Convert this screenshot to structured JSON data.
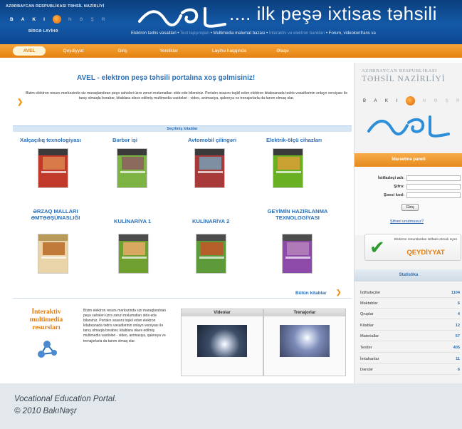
{
  "header": {
    "ministry": "AZƏRBAYCAN RESPUBLİKASI TƏHSİL NAZİRLİYİ",
    "baki_letters": [
      "B",
      "A",
      "K",
      "I"
    ],
    "nesr_letters": [
      "N",
      "Ə",
      "Ş",
      "R"
    ],
    "project": "BİRGƏ LAYİHƏ",
    "title": ".... ilk peşə ixtisas təhsili",
    "links_1": "Elektron tədris vəsaitləri •",
    "links_faded_1": " Test tapşırıqları ",
    "links_2": "• Multimedia məlumat bazası •",
    "links_faded_2": " İnteraktiv və elektron bankları ",
    "links_3": "• Forum, videokonfrans və"
  },
  "nav": {
    "items": [
      "AVEL",
      "Qeydiyyat",
      "Giriş",
      "Yeniliklər",
      "Layihə haqqında",
      "Əlaqə"
    ]
  },
  "main": {
    "welcome": "AVEL - elektron peşə təhsili portalına xoş gəlmisiniz!",
    "intro": "Bizim elektron resurs mərkəzində siz maraqlandıran peşə sahələri üzrə zəruri məlumatları əldə edə bilərsiniz. Portalın əsasını təşkil edən elektron kitabxanada tədris vəsaitlərinin onlayn versiyası ilə tanış olmaqla bərabər, kitablara əlavə edilmiş multimedia vasitələri - video, animasiya, qalereya və trenajorlarla da tanım olmaq olar.",
    "selected_books": "Seçilmiş kitablar",
    "books": [
      {
        "title": "Xalçaçılıq texnologiyası",
        "color": "#c0392b"
      },
      {
        "title": "Bərbər işi",
        "color": "#7cb342"
      },
      {
        "title": "Avtomobil çilingəri",
        "color": "#a83a3a"
      },
      {
        "title": "Elektrik-ölçü cihazları",
        "color": "#6ab023"
      },
      {
        "title_1": "ƏRZAQ MALLARI",
        "title_2": "ƏMTƏƏŞÜNASLIĞI",
        "color": "#e8d4a8"
      },
      {
        "title": "KULİNARİYA 1",
        "color": "#6f9f2e"
      },
      {
        "title": "KULİNARİYA 2",
        "color": "#5d9b3a"
      },
      {
        "title_1": "GEYİMİN HAZIRLANMA",
        "title_2": "TEXNOLOGİYASI",
        "color": "#8e4aa8"
      }
    ],
    "all_books": "Bütün kitablar",
    "interactive_title": "İnteraktiv multimedia resursları",
    "interactive_desc": "Bizim elektron resurs mərkəzində sizi maraqlandıran peşə sahələri üzrə zəruri məlumatları əldə edə bilərsiniz. Portalın əsasını təşkil edən elektron kitabxanada tədris vəsaitlərinin onlayn versiyası ilə tanış olmaqla bərabər, kitablara əlavə edilmiş multimedia vasitələri - video, animasiya, qalereya və trenajorlarla da tanım olmaq olar.",
    "videos": "Videolar",
    "trainers": "Trenajorlar"
  },
  "sidebar": {
    "ministry_1": "AZƏRBAYCAN RESPUBLİKASI",
    "ministry_2": "TƏHSİL NAZİRLİYİ",
    "login_head": "İdarəetmə paneli",
    "username": "İstifadəçi adı:",
    "password": "Şifrə:",
    "code": "Şəxsi kod:",
    "login_btn": "Giriş",
    "forgot": "Şifrəni unutmusuz?",
    "register_note": "Elektron resurslardan istifadə etmək üçün",
    "register": "QEYDİYYAT",
    "stats_head": "Statistika",
    "stats": [
      {
        "label": "İstifadəçilər",
        "value": "1104"
      },
      {
        "label": "Məktəblər",
        "value": "6"
      },
      {
        "label": "Qruplar",
        "value": "4"
      },
      {
        "label": "Kitablar",
        "value": "12"
      },
      {
        "label": "Materiallar",
        "value": "57"
      },
      {
        "label": "Testlər",
        "value": "405"
      },
      {
        "label": "İmtahanlar",
        "value": "11"
      },
      {
        "label": "Dərslər",
        "value": "6"
      }
    ]
  },
  "caption": {
    "line1": "Vocational Education Portal.",
    "line2": "© 2010 BakıNəşr"
  }
}
